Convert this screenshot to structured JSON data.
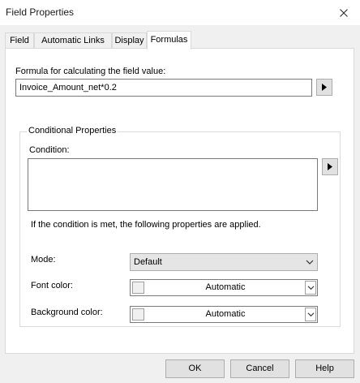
{
  "window": {
    "title": "Field Properties"
  },
  "tabs": [
    {
      "label": "Field",
      "active": false
    },
    {
      "label": "Automatic Links",
      "active": false
    },
    {
      "label": "Display",
      "active": false
    },
    {
      "label": "Formulas",
      "active": true
    }
  ],
  "formula": {
    "label": "Formula for calculating the field value:",
    "value": "Invoice_Amount_net*0.2"
  },
  "conditional": {
    "group_label": "Conditional Properties",
    "condition_label": "Condition:",
    "condition_value": "",
    "note": "If the condition is met, the following properties are applied.",
    "mode_label": "Mode:",
    "mode_value": "Default",
    "font_color_label": "Font color:",
    "font_color_value": "Automatic",
    "background_color_label": "Background color:",
    "background_color_value": "Automatic"
  },
  "buttons": {
    "ok": "OK",
    "cancel": "Cancel",
    "help": "Help"
  },
  "colors": {
    "panel": "#ffffff",
    "dialog": "#f0f0f0",
    "button": "#e1e1e1",
    "combo": "#e5e5e5"
  },
  "icons": {
    "close": "close-icon",
    "arrow": "triangle-right-icon",
    "dropdown": "chevron-down-icon"
  }
}
